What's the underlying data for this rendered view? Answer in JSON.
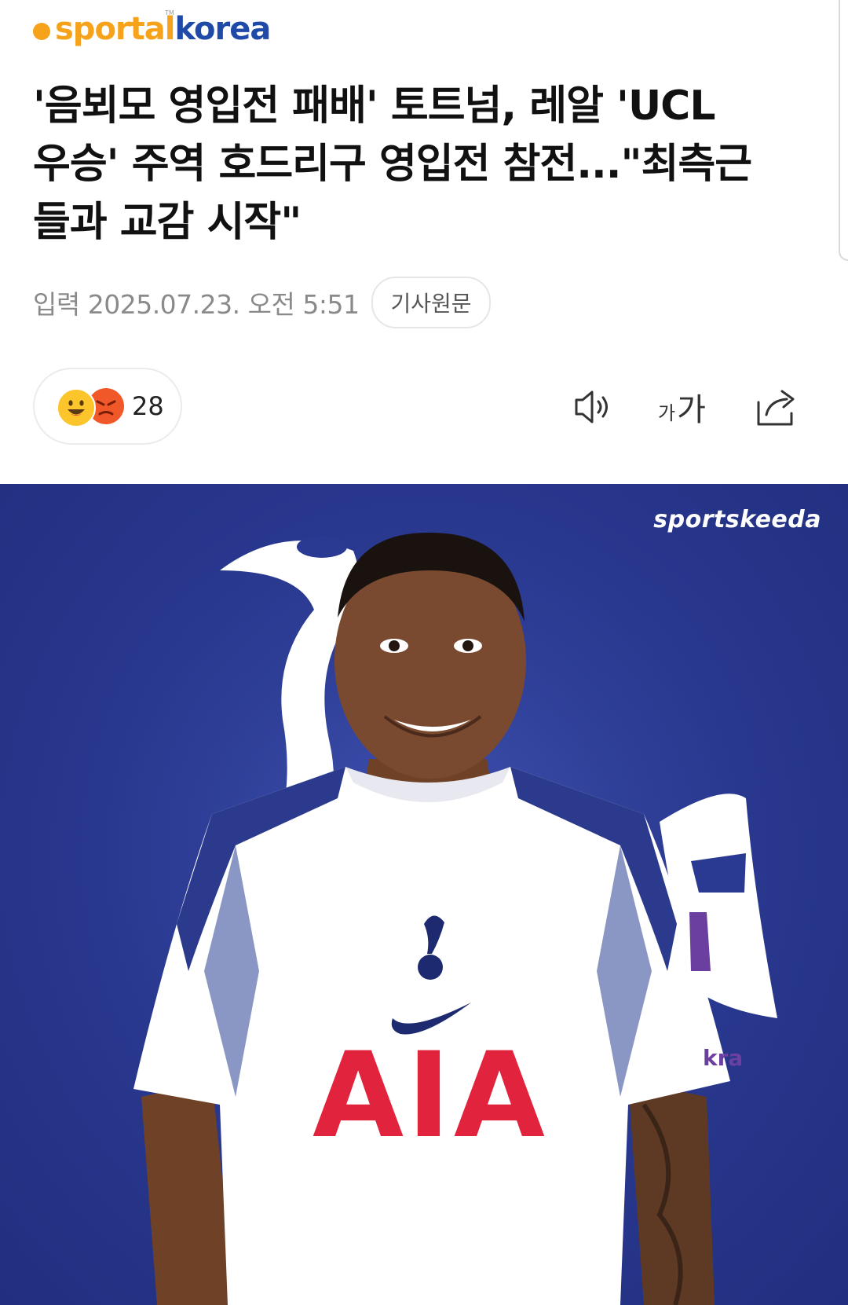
{
  "logo": {
    "part1": "sportal",
    "part2": "korea",
    "tm": "TM"
  },
  "article": {
    "headline_lines": [
      "'음뵈모 영입전 패배' 토트넘, 레알 'UCL",
      "우승' 주역 호드리구 영입전 참전...\"최측근",
      "들과 교감 시작\""
    ],
    "date": "입력 2025.07.23. 오전 5:51",
    "original_button": "기사원문"
  },
  "reactions": {
    "count": "28",
    "emojis": [
      "happy-face-icon",
      "angry-face-icon"
    ]
  },
  "toolbar": {
    "icons": [
      "speaker-icon",
      "font-size-icon",
      "share-icon"
    ],
    "font_small": "가",
    "font_big": "가"
  },
  "hero_image": {
    "watermark": "sportskeeda",
    "shirt_sponsor": "AIA",
    "sleeve_text": "kra",
    "colors": {
      "background": "#2a3a92",
      "shirt": "#ffffff",
      "shirt_accent": "#2b3a8c",
      "sponsor": "#e2233d",
      "skin": "#7a4a30"
    }
  },
  "colors": {
    "logo_orange": "#f6a21a",
    "logo_blue": "#1f4aa8",
    "meta_gray": "#8a8a8a"
  }
}
